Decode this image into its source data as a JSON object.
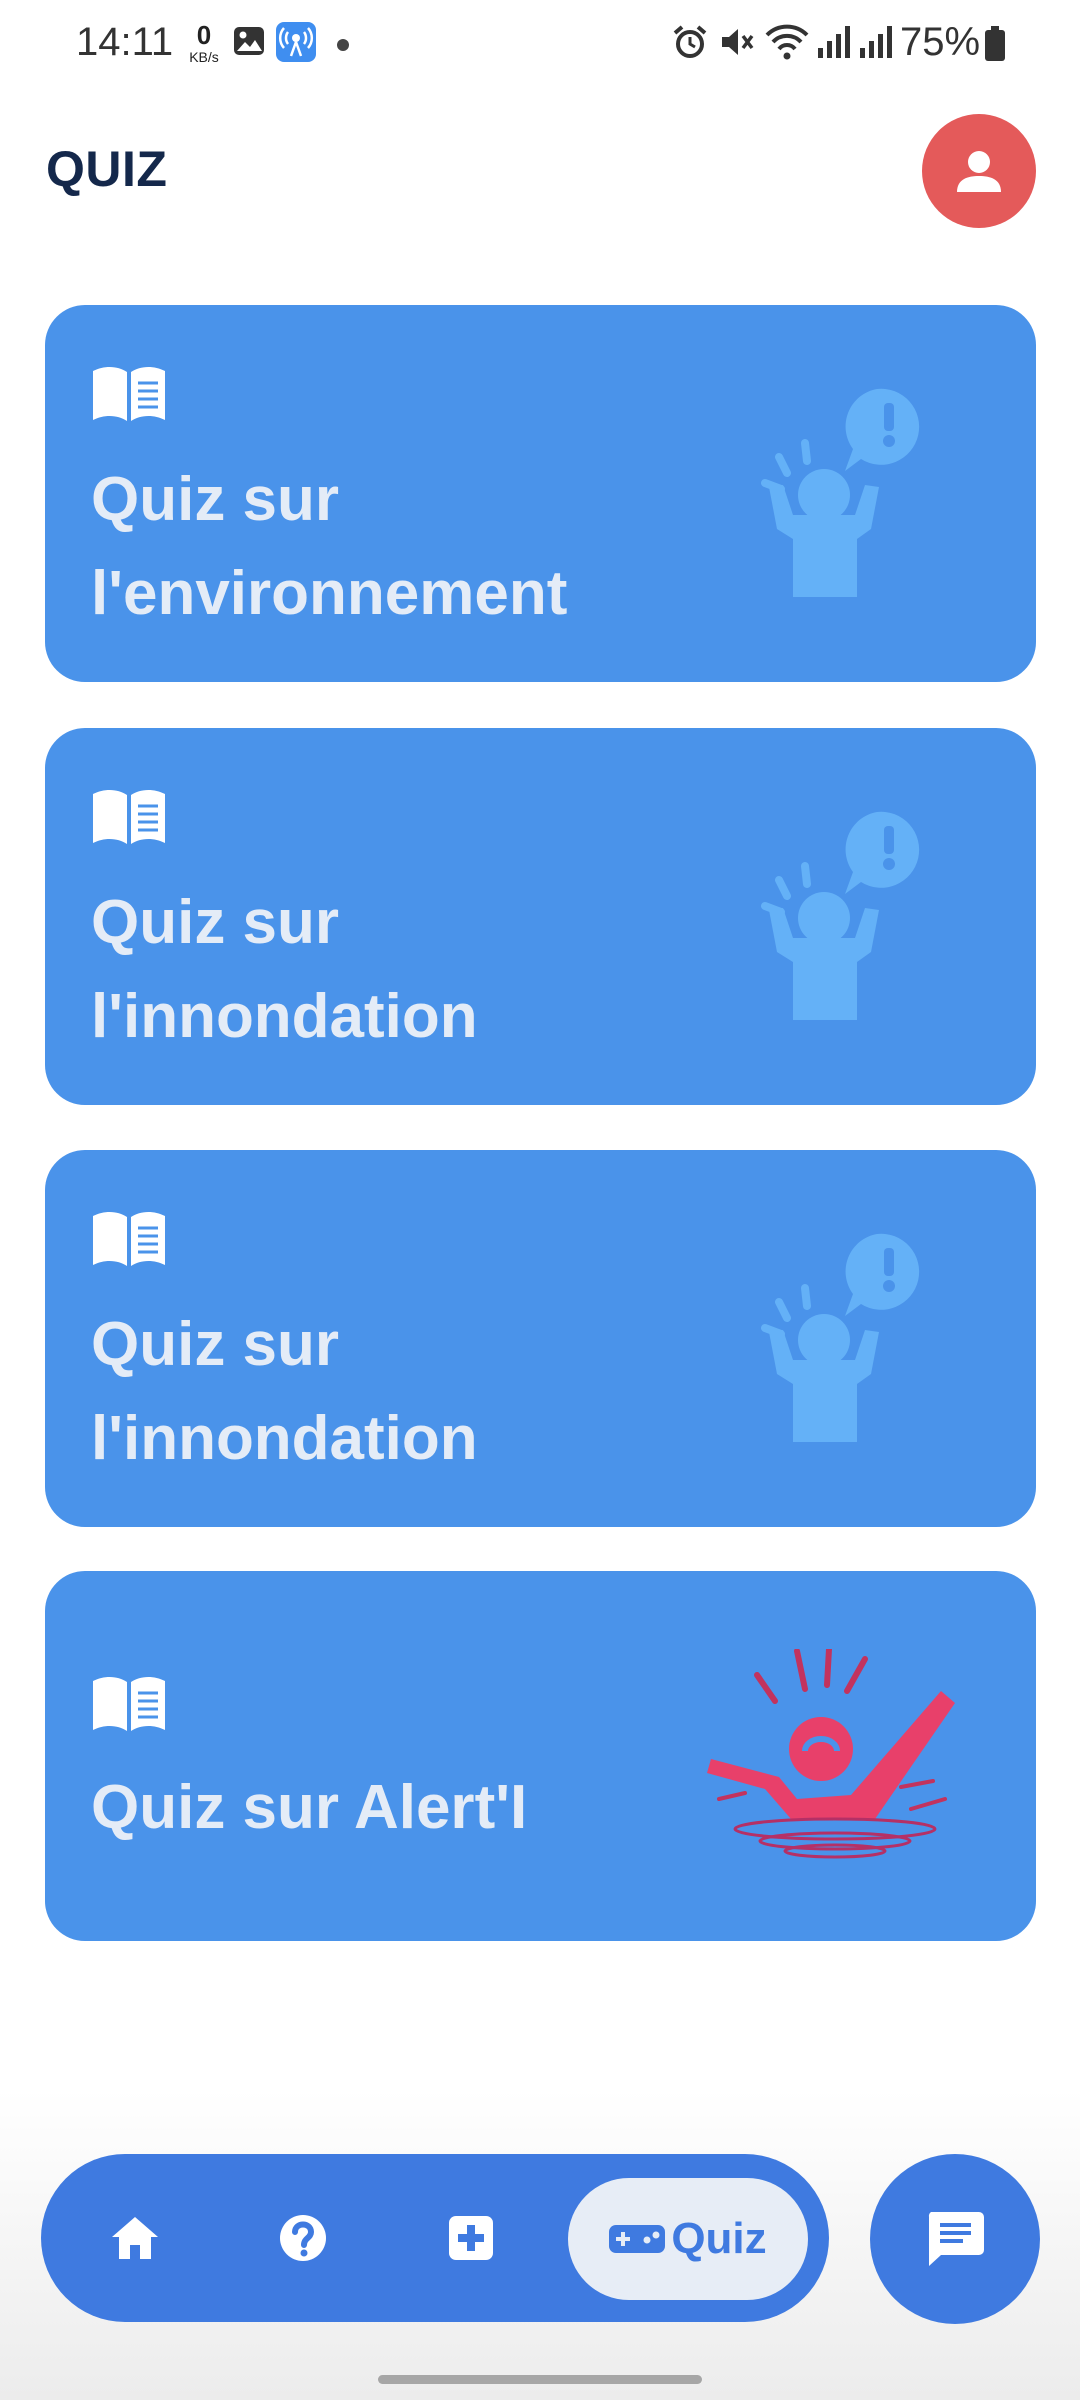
{
  "status_bar": {
    "time": "14:11",
    "net_speed_value": "0",
    "net_speed_unit": "KB/s",
    "battery_percent": "75%",
    "icons": [
      "gallery-icon",
      "hotspot-icon",
      "alarm-icon",
      "mute-icon",
      "wifi-icon",
      "signal-icon",
      "battery-icon"
    ]
  },
  "header": {
    "title": "QUIZ",
    "profile_icon": "person-icon",
    "profile_color": "#e45a5a"
  },
  "quizzes": [
    {
      "title_line1": "Quiz sur",
      "title_line2": "l'environnement",
      "icon": "book-icon",
      "illustration": "alarmed-person-icon"
    },
    {
      "title_line1": "Quiz sur",
      "title_line2": "l'innondation",
      "icon": "book-icon",
      "illustration": "alarmed-person-icon"
    },
    {
      "title_line1": "Quiz sur",
      "title_line2": "l'innondation",
      "icon": "book-icon",
      "illustration": "alarmed-person-icon"
    },
    {
      "title_line1": "Quiz sur Alert'I",
      "icon": "book-icon",
      "illustration": "drowning-person-icon"
    }
  ],
  "bottom_nav": {
    "items": [
      {
        "icon": "home-icon"
      },
      {
        "icon": "help-icon"
      },
      {
        "icon": "medical-plus-icon"
      },
      {
        "icon": "gamepad-icon",
        "label": "Quiz",
        "active": true
      }
    ],
    "chat_icon": "chat-icon"
  },
  "colors": {
    "card": "#4a93ea",
    "nav": "#3f7ae0",
    "title": "#14284b",
    "alert_figure": "#e8406a"
  }
}
